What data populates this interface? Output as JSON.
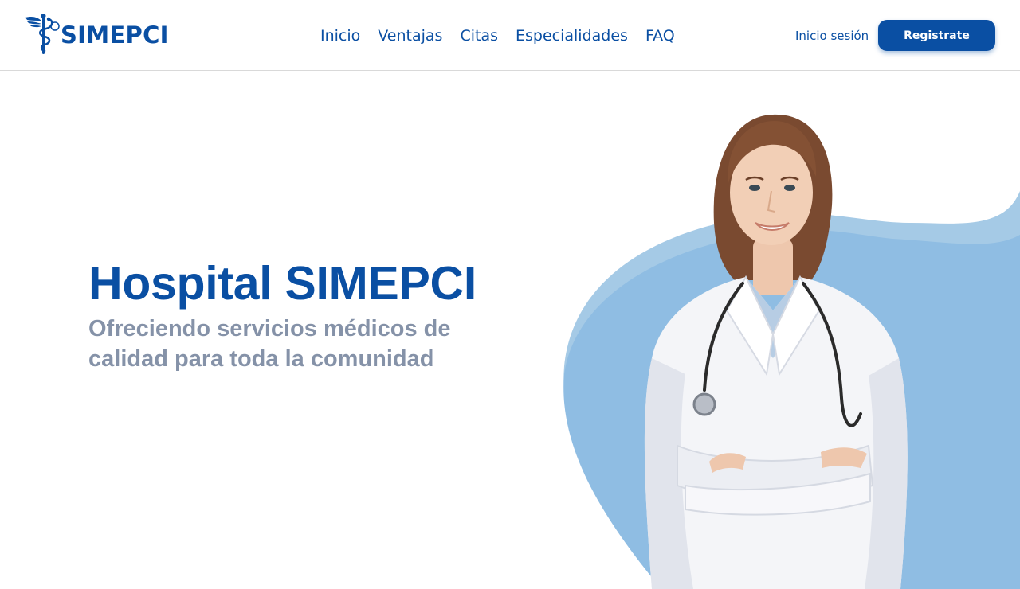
{
  "brand": {
    "name": "SIMEPCI",
    "logo_icon": "caduceus-icon",
    "primary_color": "#0a4fa3",
    "accent_color": "#8fbde3"
  },
  "nav": {
    "items": [
      {
        "label": "Inicio"
      },
      {
        "label": "Ventajas"
      },
      {
        "label": "Citas"
      },
      {
        "label": "Especialidades"
      },
      {
        "label": "FAQ"
      }
    ]
  },
  "auth": {
    "login_label": "Inicio sesión",
    "register_label": "Registrate"
  },
  "hero": {
    "title": "Hospital SIMEPCI",
    "subtitle": "Ofreciendo servicios médicos de calidad para toda la comunidad",
    "image": "doctor-portrait"
  }
}
